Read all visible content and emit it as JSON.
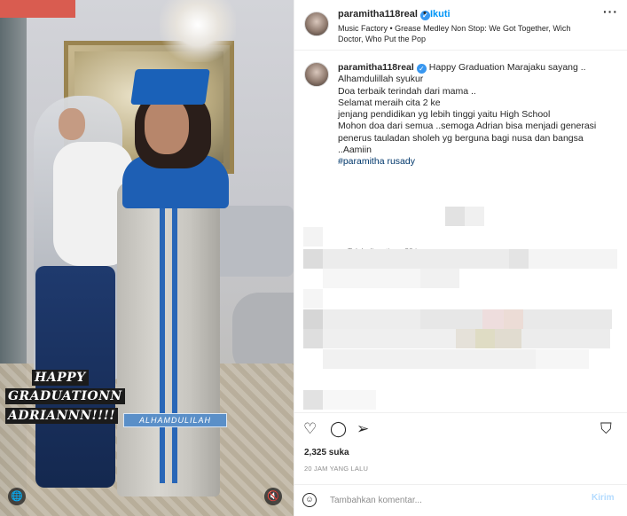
{
  "post": {
    "username": "paramitha118real",
    "follow_label": "Ikuti",
    "separator": "•",
    "more_label": "···",
    "music": "Music Factory • Grease Medley Non Stop: We Got Together, Wich Doctor, Who Put the Pop"
  },
  "media": {
    "overlay_line1": "HAPPY",
    "overlay_line2": "GRADUATIONN",
    "overlay_line3": "ADRIANNN!!!!",
    "sticker_text": "ALHAMDULILAH",
    "left_icon": "🌐",
    "mute_icon": "🔇"
  },
  "caption": {
    "username": "paramitha118real",
    "lines": [
      "Happy Graduation Marajaku sayang ..",
      "Alhamdulillah syukur",
      "Doa terbaik terindah dari mama ..",
      "Selamat meraih cita 2 ke",
      "jenjang pendidikan yg lebih tinggi yaitu High School",
      "Mohon doa dari semua ..semoga Adrian bisa menjadi generasi",
      "penerus tauladan sholeh yg berguna bagi nusa dan bangsa",
      "..Aamiin"
    ],
    "hashtag": "#paramitha rusady",
    "meta": "Telah disunting · 20 jam"
  },
  "actions": {
    "like_icon": "♡",
    "comment_icon": "◯",
    "share_icon": "➢",
    "save_icon": "⛉",
    "likes": "2,325 suka",
    "time_ago": "20 JAM YANG LALU"
  },
  "comment_bar": {
    "emoji_icon": "☺",
    "placeholder": "Tambahkan komentar...",
    "post_label": "Kirim"
  },
  "colors": {
    "link_blue": "#0095f6",
    "verified_blue": "#3897f0",
    "muted_gray": "#8e8e8e",
    "border": "#efefef"
  }
}
